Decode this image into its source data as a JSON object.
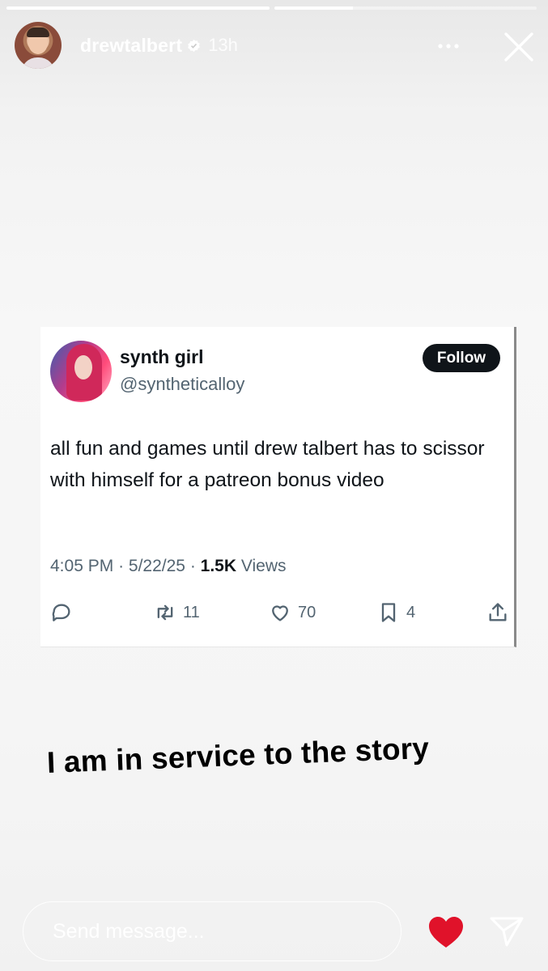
{
  "story": {
    "progress": [
      1.0,
      0.3
    ],
    "user": {
      "username": "drewtalbert",
      "time": "13h",
      "verified": true
    }
  },
  "tweet": {
    "name": "synth girl",
    "handle": "@syntheticalloy",
    "follow_label": "Follow",
    "text": "all fun and games until drew talbert has to scissor with himself for a patreon bonus video",
    "time": "4:05 PM",
    "date": "5/22/25",
    "views_count": "1.5K",
    "views_label": "Views",
    "retweets": "11",
    "likes": "70",
    "bookmarks": "4"
  },
  "caption": "I am in service to the story",
  "footer": {
    "message_placeholder": "Send message...",
    "heart_color": "#e0122a"
  }
}
